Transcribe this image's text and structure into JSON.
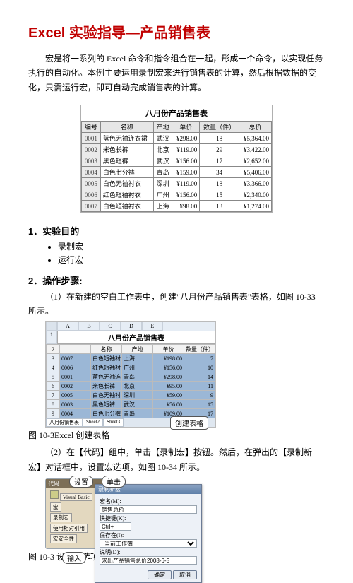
{
  "title": "Excel  实验指导—产品销售表",
  "intro": "宏是将一系列的 Excel 命令和指令组合在一起，形成一个命令，以实现任务执行的自动化。本例主要运用录制宏来进行销售表的计算，然后根据数据的变化，只需运行宏，即可自动完成销售表的计算。",
  "sales": {
    "caption": "八月份产品销售表",
    "headers": [
      "编号",
      "名称",
      "产地",
      "单价",
      "数量（件）",
      "总价"
    ],
    "rows": [
      [
        "0001",
        "蓝色无袖连衣裙",
        "武汉",
        "¥298.00",
        "18",
        "¥5,364.00"
      ],
      [
        "0002",
        "米色长裤",
        "北京",
        "¥119.00",
        "29",
        "¥3,422.00"
      ],
      [
        "0003",
        "黑色短裤",
        "武汉",
        "¥156.00",
        "17",
        "¥2,652.00"
      ],
      [
        "0004",
        "白色七分裤",
        "青岛",
        "¥159.00",
        "34",
        "¥5,406.00"
      ],
      [
        "0005",
        "白色无袖衬衣",
        "深圳",
        "¥119.00",
        "18",
        "¥3,366.00"
      ],
      [
        "0006",
        "红色短袖衬衣",
        "广州",
        "¥156.00",
        "15",
        "¥2,340.00"
      ],
      [
        "0007",
        "白色短袖衬衣",
        "上海",
        "¥98.00",
        "13",
        "¥1,274.00"
      ]
    ]
  },
  "sec1": "1．实验目的",
  "bullets": [
    "录制宏",
    "运行宏"
  ],
  "sec2": "2．操作步骤:",
  "step1": "（1）在新建的空白工作表中，创建\"八月份产品销售表\"表格，如图 10-33 所示。",
  "shot1": {
    "title": "八月份产品销售表",
    "cols": [
      "",
      "A",
      "B",
      "C",
      "D",
      "E"
    ],
    "hdr": [
      "名称",
      "产地",
      "单价",
      "数量（件）"
    ],
    "rows": [
      [
        "3",
        "0007",
        "白色短袖衬衣",
        "上海",
        "¥198.00",
        "7"
      ],
      [
        "4",
        "0006",
        "红色短袖衬衣",
        "广州",
        "¥156.00",
        "10"
      ],
      [
        "5",
        "0001",
        "蓝色无袖连衣裙",
        "青岛",
        "¥298.00",
        "14"
      ],
      [
        "6",
        "0002",
        "米色长裤",
        "北京",
        "¥95.00",
        "11"
      ],
      [
        "7",
        "0005",
        "白色无袖衬衣",
        "深圳",
        "¥59.00",
        "9"
      ],
      [
        "8",
        "0003",
        "黑色短裤",
        "武汉",
        "¥56.00",
        "15"
      ],
      [
        "9",
        "0004",
        "白色七分裤",
        "青岛",
        "¥109.00",
        "17"
      ]
    ],
    "tabs": [
      "八月份销售表",
      "Sheet2",
      "Sheet3"
    ],
    "callout": "创建表格"
  },
  "caption1": "图 10-3Excel 创建表格",
  "step2": "（2）在【代码】组中，单击【录制宏】按钮。然后，在弹出的【录制新宏】对话框中，设置宏选项，如图 10-34 所示。",
  "shot2": {
    "group_title": "代码",
    "group_items": [
      "Visual Basic",
      "宏",
      "录制宏",
      "使用相对引用",
      "宏安全性"
    ],
    "dlg_title": "录制新宏",
    "lbl_name": "宏名(M):",
    "val_name": "销售总价",
    "lbl_key": "快捷键(K):",
    "val_key": "Ctrl+",
    "lbl_store": "保存在(I):",
    "val_store": "当前工作簿",
    "lbl_desc": "说明(D):",
    "val_desc": "求出产品销售总价2008-6-5",
    "ok": "确定",
    "cancel": "取消",
    "co_set": "设置",
    "co_click": "单击",
    "co_input": "输入"
  },
  "caption2": "图 10-3 设置宏选项"
}
